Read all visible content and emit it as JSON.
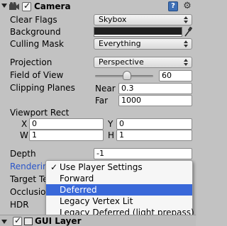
{
  "component": {
    "title": "Camera",
    "enabled": true,
    "help_icon": "help-icon",
    "settings_icon": "gear-icon"
  },
  "fields": {
    "clear_flags": {
      "label": "Clear Flags",
      "value": "Skybox"
    },
    "background": {
      "label": "Background",
      "color": "#1f1f1f"
    },
    "culling_mask": {
      "label": "Culling Mask",
      "value": "Everything"
    },
    "projection": {
      "label": "Projection",
      "value": "Perspective"
    },
    "field_of_view": {
      "label": "Field of View",
      "value": "60",
      "slider_fraction": 0.55
    },
    "clipping_planes": {
      "label": "Clipping Planes",
      "near_label": "Near",
      "near_value": "0.3",
      "far_label": "Far",
      "far_value": "1000"
    },
    "viewport_rect": {
      "label": "Viewport Rect",
      "x_label": "X",
      "x_value": "0",
      "y_label": "Y",
      "y_value": "0",
      "w_label": "W",
      "w_value": "1",
      "h_label": "H",
      "h_value": "1"
    },
    "depth": {
      "label": "Depth",
      "value": "-1"
    },
    "rendering_path": {
      "label": "Rendering Path"
    },
    "target_texture": {
      "label": "Target Texture"
    },
    "occlusion_culling": {
      "label": "Occlusion Culling"
    },
    "hdr": {
      "label": "HDR"
    }
  },
  "rendering_menu": {
    "checked_mark": "✓",
    "items": [
      {
        "label": "Use Player Settings",
        "checked": true,
        "highlighted": false
      },
      {
        "label": "Forward",
        "checked": false,
        "highlighted": false
      },
      {
        "label": "Deferred",
        "checked": false,
        "highlighted": true
      },
      {
        "label": "Legacy Vertex Lit",
        "checked": false,
        "highlighted": false
      },
      {
        "label": "Legacy Deferred (light prepass)",
        "checked": false,
        "highlighted": false
      }
    ]
  },
  "next_component": {
    "title": "GUI Layer",
    "enabled": true
  },
  "colors": {
    "highlight": "#3968d9",
    "panel": "#c2c2c2"
  }
}
